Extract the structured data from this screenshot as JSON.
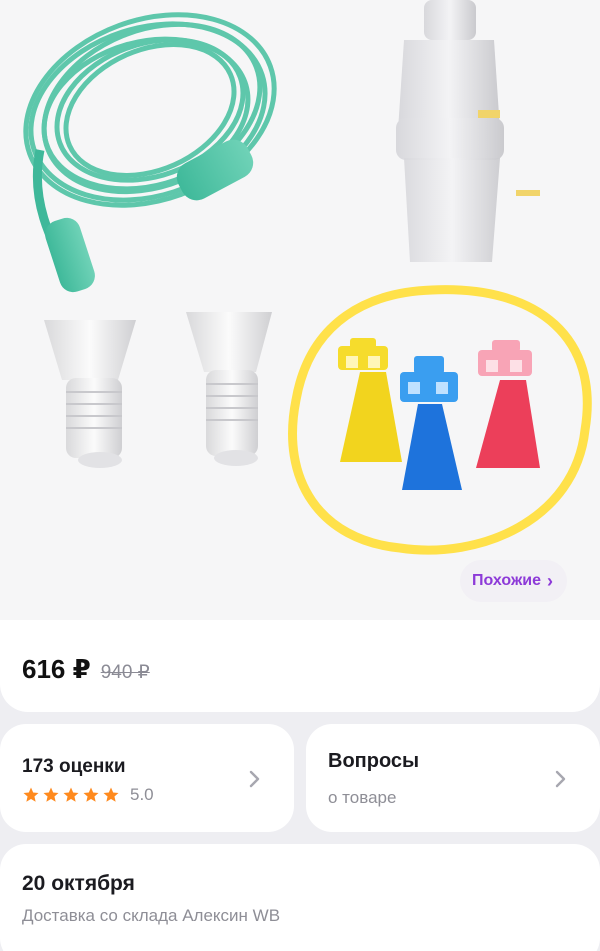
{
  "product": {
    "similar_label": "Похожие",
    "price": "616 ₽",
    "old_price": "940 ₽"
  },
  "rating": {
    "count_label": "173 оценки",
    "value": "5.0",
    "stars": 5
  },
  "questions": {
    "title": "Вопросы",
    "subtitle": "о товаре"
  },
  "delivery": {
    "date": "20 октября",
    "source": "Доставка со склада Алексин WB"
  },
  "colors": {
    "accent": "#8d3ad8",
    "star": "#ff8a1e",
    "highlight": "#ffe14a"
  },
  "icons": [
    "chevron-right-icon",
    "star-icon"
  ]
}
